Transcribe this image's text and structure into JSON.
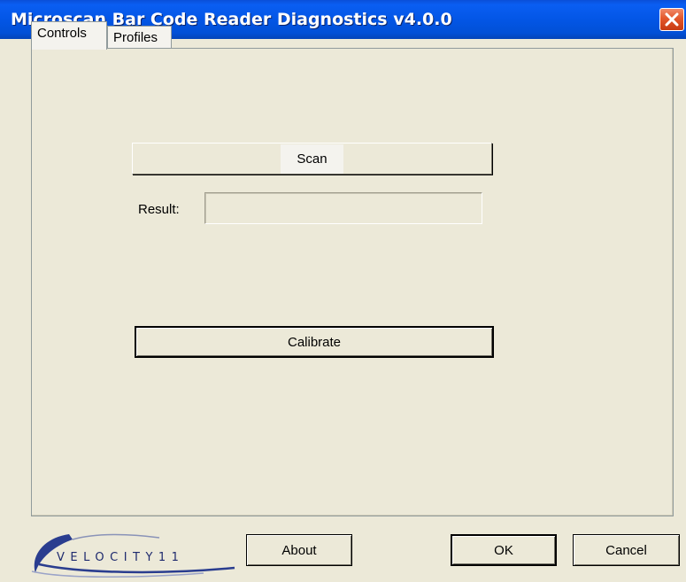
{
  "window": {
    "title": "Microscan Bar Code Reader Diagnostics v4.0.0",
    "close_icon": "close-icon",
    "accent_color": "#0356e6",
    "close_color": "#e3572b",
    "background_color": "#ece9d8"
  },
  "tabs": [
    {
      "label": "Controls",
      "active": true
    },
    {
      "label": "Profiles",
      "active": false
    }
  ],
  "controls": {
    "scan_label": "Scan",
    "result_label": "Result:",
    "result_value": "",
    "result_placeholder": "",
    "calibrate_label": "Calibrate"
  },
  "footer": {
    "logo_text": "VELOCITY11",
    "about_label": "About",
    "ok_label": "OK",
    "cancel_label": "Cancel"
  }
}
